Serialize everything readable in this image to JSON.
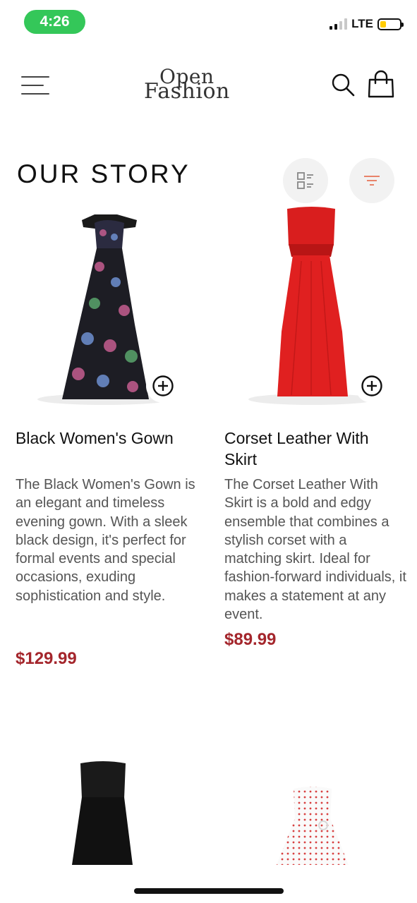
{
  "status_bar": {
    "time": "4:26",
    "network": "LTE"
  },
  "header": {
    "logo_line1": "Open",
    "logo_line2": "Fashion"
  },
  "page": {
    "title": "OUR STORY"
  },
  "products": [
    {
      "name": "Black Women's Gown",
      "description": "The Black Women's Gown is an elegant and timeless evening gown. With a sleek black design, it's perfect for formal events and special occasions, exuding sophistication and style.",
      "price": "$129.99"
    },
    {
      "name": "Corset Leather With Skirt",
      "description": "The Corset Leather With Skirt is a bold and edgy ensemble that combines a stylish corset with a matching skirt. Ideal for fashion-forward individuals, it makes a statement at any event.",
      "price": "$89.99"
    }
  ],
  "icons": {
    "menu": "menu-icon",
    "search": "search-icon",
    "bag": "shopping-bag-icon",
    "layout": "list-layout-icon",
    "filter": "filter-icon",
    "add": "plus-circle-icon"
  },
  "colors": {
    "price": "#a4262c",
    "status_pill": "#34c759",
    "filter_accent": "#e8836a"
  }
}
